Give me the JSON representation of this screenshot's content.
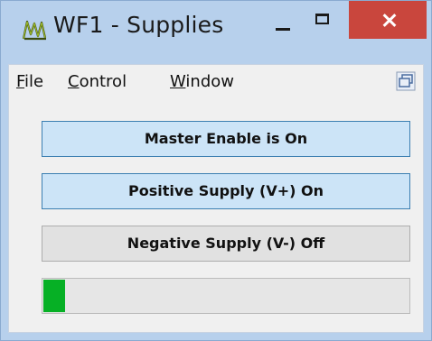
{
  "window": {
    "title": "WF1 - Supplies",
    "accent_close": "#c9463d",
    "frame_color": "#b7d0ec"
  },
  "icons": {
    "app": "waveform-app-icon",
    "minimize": "minimize-icon",
    "maximize": "maximize-icon",
    "close": "close-icon",
    "mdi_restore": "mdi-restore-icon"
  },
  "menu": {
    "file": {
      "accel": "F",
      "rest": "ile"
    },
    "control": {
      "accel": "C",
      "rest": "ontrol"
    },
    "window": {
      "accel": "W",
      "rest": "indow"
    }
  },
  "buttons": {
    "master_enable": {
      "label": "Master Enable is On",
      "state": "on"
    },
    "positive_supply": {
      "label": "Positive Supply (V+) On",
      "state": "on"
    },
    "negative_supply": {
      "label": "Negative Supply (V-) Off",
      "state": "off"
    }
  },
  "progress": {
    "value": 0.06,
    "color": "#06b025"
  }
}
